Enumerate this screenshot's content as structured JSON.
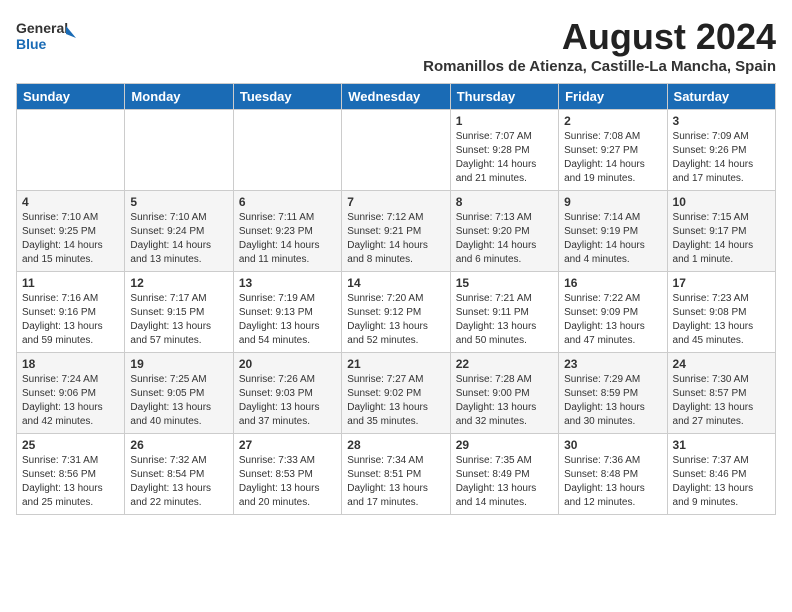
{
  "header": {
    "logo_line1": "General",
    "logo_line2": "Blue",
    "month_year": "August 2024",
    "location": "Romanillos de Atienza, Castille-La Mancha, Spain"
  },
  "weekdays": [
    "Sunday",
    "Monday",
    "Tuesday",
    "Wednesday",
    "Thursday",
    "Friday",
    "Saturday"
  ],
  "weeks": [
    [
      {
        "day": "",
        "info": ""
      },
      {
        "day": "",
        "info": ""
      },
      {
        "day": "",
        "info": ""
      },
      {
        "day": "",
        "info": ""
      },
      {
        "day": "1",
        "info": "Sunrise: 7:07 AM\nSunset: 9:28 PM\nDaylight: 14 hours\nand 21 minutes."
      },
      {
        "day": "2",
        "info": "Sunrise: 7:08 AM\nSunset: 9:27 PM\nDaylight: 14 hours\nand 19 minutes."
      },
      {
        "day": "3",
        "info": "Sunrise: 7:09 AM\nSunset: 9:26 PM\nDaylight: 14 hours\nand 17 minutes."
      }
    ],
    [
      {
        "day": "4",
        "info": "Sunrise: 7:10 AM\nSunset: 9:25 PM\nDaylight: 14 hours\nand 15 minutes."
      },
      {
        "day": "5",
        "info": "Sunrise: 7:10 AM\nSunset: 9:24 PM\nDaylight: 14 hours\nand 13 minutes."
      },
      {
        "day": "6",
        "info": "Sunrise: 7:11 AM\nSunset: 9:23 PM\nDaylight: 14 hours\nand 11 minutes."
      },
      {
        "day": "7",
        "info": "Sunrise: 7:12 AM\nSunset: 9:21 PM\nDaylight: 14 hours\nand 8 minutes."
      },
      {
        "day": "8",
        "info": "Sunrise: 7:13 AM\nSunset: 9:20 PM\nDaylight: 14 hours\nand 6 minutes."
      },
      {
        "day": "9",
        "info": "Sunrise: 7:14 AM\nSunset: 9:19 PM\nDaylight: 14 hours\nand 4 minutes."
      },
      {
        "day": "10",
        "info": "Sunrise: 7:15 AM\nSunset: 9:17 PM\nDaylight: 14 hours\nand 1 minute."
      }
    ],
    [
      {
        "day": "11",
        "info": "Sunrise: 7:16 AM\nSunset: 9:16 PM\nDaylight: 13 hours\nand 59 minutes."
      },
      {
        "day": "12",
        "info": "Sunrise: 7:17 AM\nSunset: 9:15 PM\nDaylight: 13 hours\nand 57 minutes."
      },
      {
        "day": "13",
        "info": "Sunrise: 7:19 AM\nSunset: 9:13 PM\nDaylight: 13 hours\nand 54 minutes."
      },
      {
        "day": "14",
        "info": "Sunrise: 7:20 AM\nSunset: 9:12 PM\nDaylight: 13 hours\nand 52 minutes."
      },
      {
        "day": "15",
        "info": "Sunrise: 7:21 AM\nSunset: 9:11 PM\nDaylight: 13 hours\nand 50 minutes."
      },
      {
        "day": "16",
        "info": "Sunrise: 7:22 AM\nSunset: 9:09 PM\nDaylight: 13 hours\nand 47 minutes."
      },
      {
        "day": "17",
        "info": "Sunrise: 7:23 AM\nSunset: 9:08 PM\nDaylight: 13 hours\nand 45 minutes."
      }
    ],
    [
      {
        "day": "18",
        "info": "Sunrise: 7:24 AM\nSunset: 9:06 PM\nDaylight: 13 hours\nand 42 minutes."
      },
      {
        "day": "19",
        "info": "Sunrise: 7:25 AM\nSunset: 9:05 PM\nDaylight: 13 hours\nand 40 minutes."
      },
      {
        "day": "20",
        "info": "Sunrise: 7:26 AM\nSunset: 9:03 PM\nDaylight: 13 hours\nand 37 minutes."
      },
      {
        "day": "21",
        "info": "Sunrise: 7:27 AM\nSunset: 9:02 PM\nDaylight: 13 hours\nand 35 minutes."
      },
      {
        "day": "22",
        "info": "Sunrise: 7:28 AM\nSunset: 9:00 PM\nDaylight: 13 hours\nand 32 minutes."
      },
      {
        "day": "23",
        "info": "Sunrise: 7:29 AM\nSunset: 8:59 PM\nDaylight: 13 hours\nand 30 minutes."
      },
      {
        "day": "24",
        "info": "Sunrise: 7:30 AM\nSunset: 8:57 PM\nDaylight: 13 hours\nand 27 minutes."
      }
    ],
    [
      {
        "day": "25",
        "info": "Sunrise: 7:31 AM\nSunset: 8:56 PM\nDaylight: 13 hours\nand 25 minutes."
      },
      {
        "day": "26",
        "info": "Sunrise: 7:32 AM\nSunset: 8:54 PM\nDaylight: 13 hours\nand 22 minutes."
      },
      {
        "day": "27",
        "info": "Sunrise: 7:33 AM\nSunset: 8:53 PM\nDaylight: 13 hours\nand 20 minutes."
      },
      {
        "day": "28",
        "info": "Sunrise: 7:34 AM\nSunset: 8:51 PM\nDaylight: 13 hours\nand 17 minutes."
      },
      {
        "day": "29",
        "info": "Sunrise: 7:35 AM\nSunset: 8:49 PM\nDaylight: 13 hours\nand 14 minutes."
      },
      {
        "day": "30",
        "info": "Sunrise: 7:36 AM\nSunset: 8:48 PM\nDaylight: 13 hours\nand 12 minutes."
      },
      {
        "day": "31",
        "info": "Sunrise: 7:37 AM\nSunset: 8:46 PM\nDaylight: 13 hours\nand 9 minutes."
      }
    ]
  ]
}
